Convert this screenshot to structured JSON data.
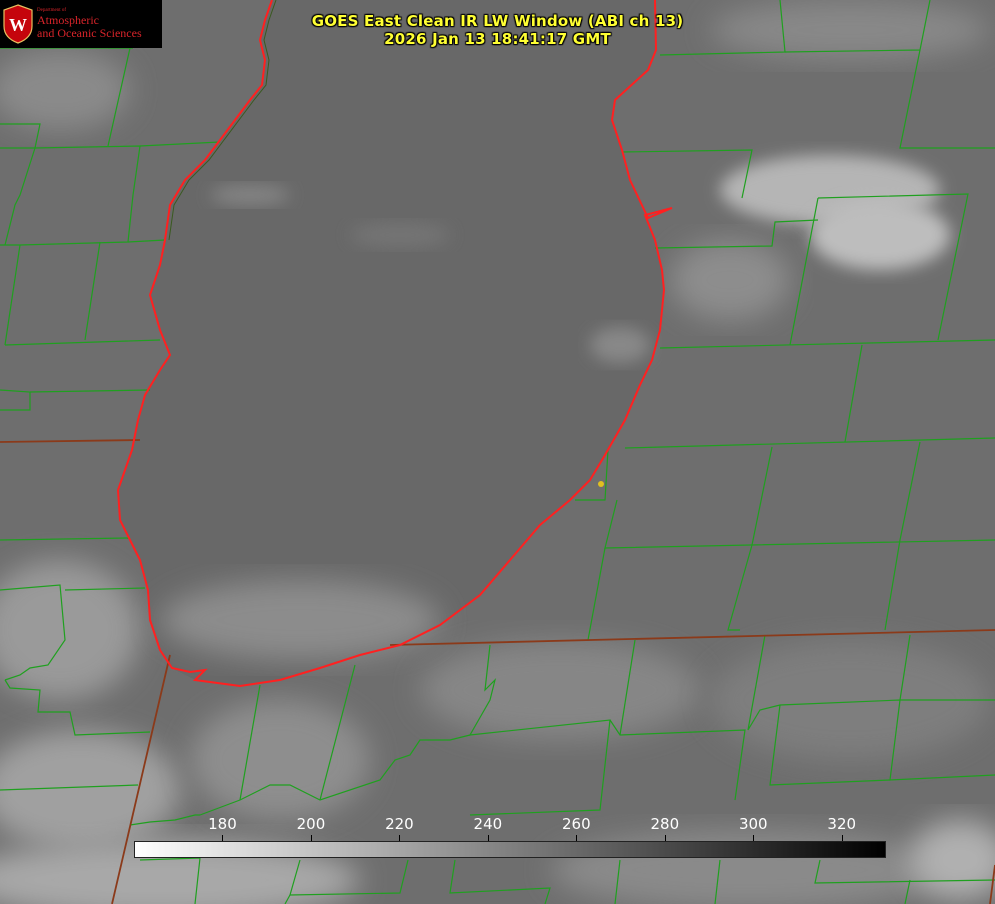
{
  "title": {
    "line1": "GOES East Clean IR LW Window (ABI ch 13)",
    "line2": "2026 Jan 13 18:41:17 GMT"
  },
  "logo": {
    "dept": "Department of",
    "line1": "Atmospheric",
    "line2": "and Oceanic Sciences",
    "seal_letter": "W",
    "color": "#d8242a"
  },
  "colorbar": {
    "min": 160,
    "max": 330,
    "ticks": [
      "180",
      "200",
      "220",
      "240",
      "260",
      "280",
      "300",
      "320"
    ],
    "tick_values": [
      180,
      200,
      220,
      240,
      260,
      280,
      300,
      320
    ]
  },
  "colors": {
    "county_lines": "#22aa22",
    "state_lines": "#8b3a1a",
    "coastline": "#ff2020",
    "title": "#ffff33",
    "marker": "#e0c020"
  }
}
